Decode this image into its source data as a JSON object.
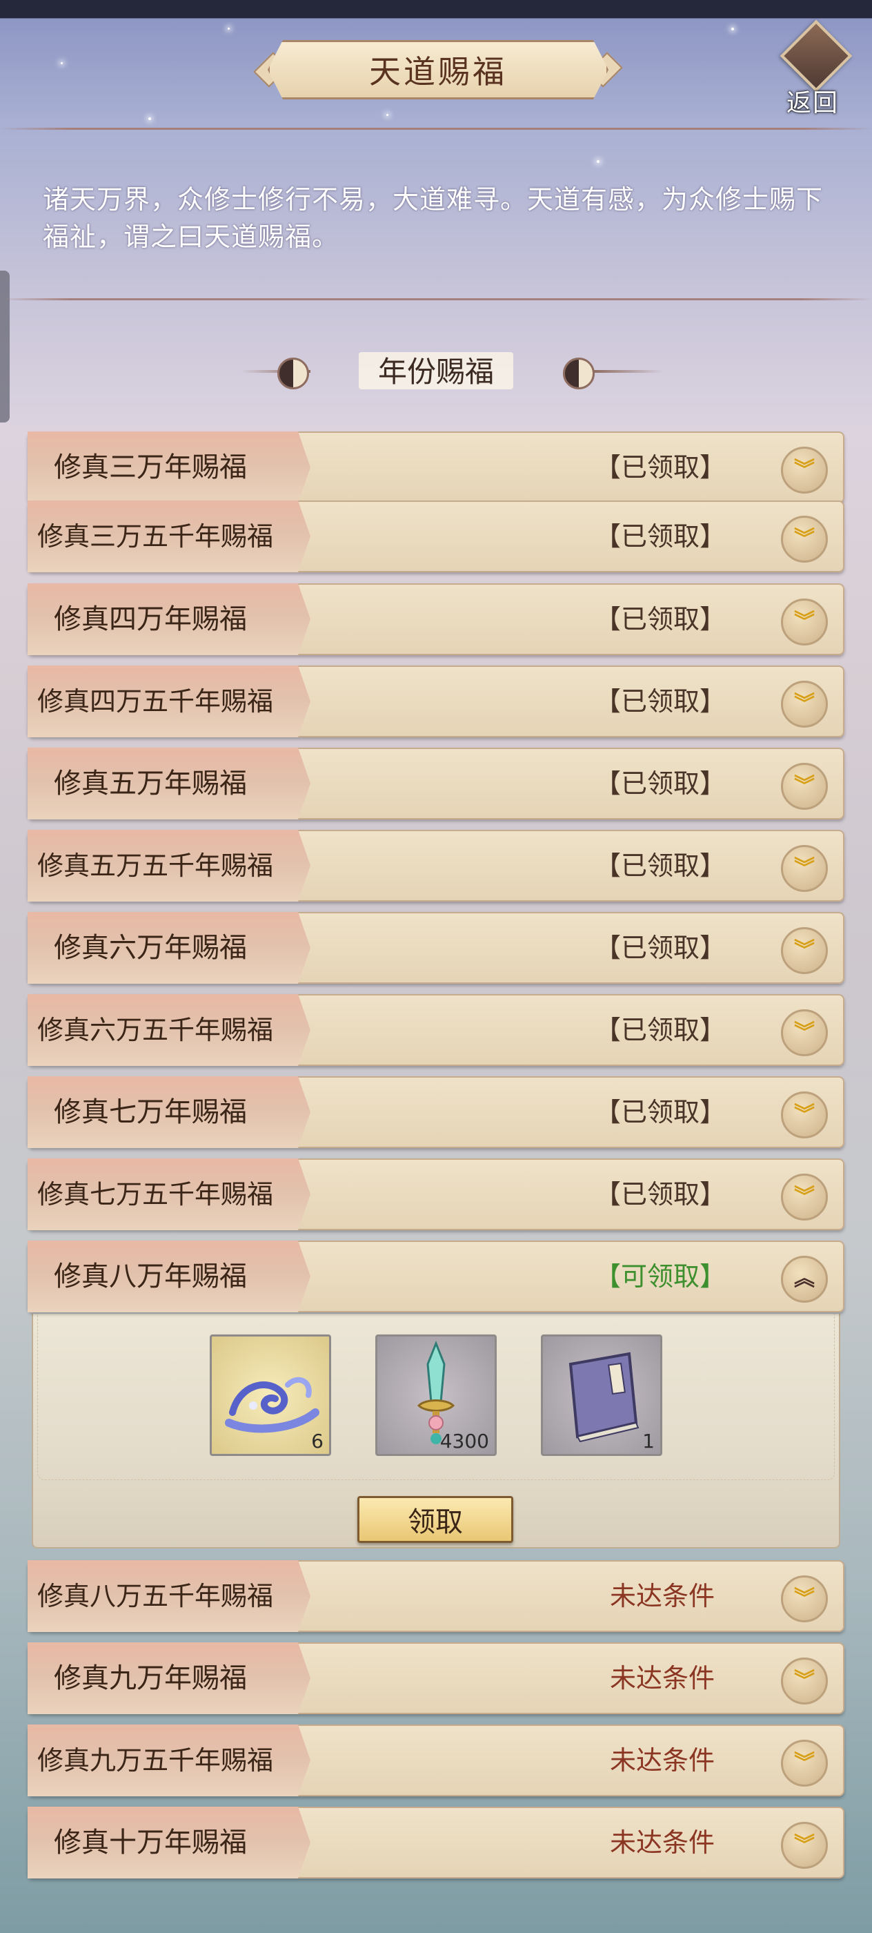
{
  "header": {
    "title": "天道赐福",
    "back_label": "返回"
  },
  "description": "诸天万界，众修士修行不易，大道难寻。天道有感，为众修士赐下福祉，谓之曰天道赐福。",
  "section": {
    "title": "年份赐福"
  },
  "rows": [
    {
      "label": "修真三万年赐福",
      "status": "【已领取】"
    },
    {
      "label": "修真三万五千年赐福",
      "status": "【已领取】"
    },
    {
      "label": "修真四万年赐福",
      "status": "【已领取】"
    },
    {
      "label": "修真四万五千年赐福",
      "status": "【已领取】"
    },
    {
      "label": "修真五万年赐福",
      "status": "【已领取】"
    },
    {
      "label": "修真五万五千年赐福",
      "status": "【已领取】"
    },
    {
      "label": "修真六万年赐福",
      "status": "【已领取】"
    },
    {
      "label": "修真六万五千年赐福",
      "status": "【已领取】"
    },
    {
      "label": "修真七万年赐福",
      "status": "【已领取】"
    },
    {
      "label": "修真七万五千年赐福",
      "status": "【已领取】"
    },
    {
      "label": "修真八万年赐福",
      "status": "【可领取】"
    },
    {
      "label": "修真八万五千年赐福",
      "status": "未达条件"
    },
    {
      "label": "修真九万年赐福",
      "status": "未达条件"
    },
    {
      "label": "修真九万五千年赐福",
      "status": "未达条件"
    },
    {
      "label": "修真十万年赐福",
      "status": "未达条件"
    }
  ],
  "expanded": {
    "items": [
      {
        "icon": "water-wave-icon",
        "count": "6"
      },
      {
        "icon": "jade-sword-icon",
        "count": "4300"
      },
      {
        "icon": "secret-manual-book-icon",
        "count": "1"
      }
    ],
    "claim_label": "领取"
  },
  "colors": {
    "claimed_text": "#4a3428",
    "claimable_text": "#3e8f2e",
    "locked_text": "#8b3523",
    "chevron_gold": "#d7a018"
  }
}
